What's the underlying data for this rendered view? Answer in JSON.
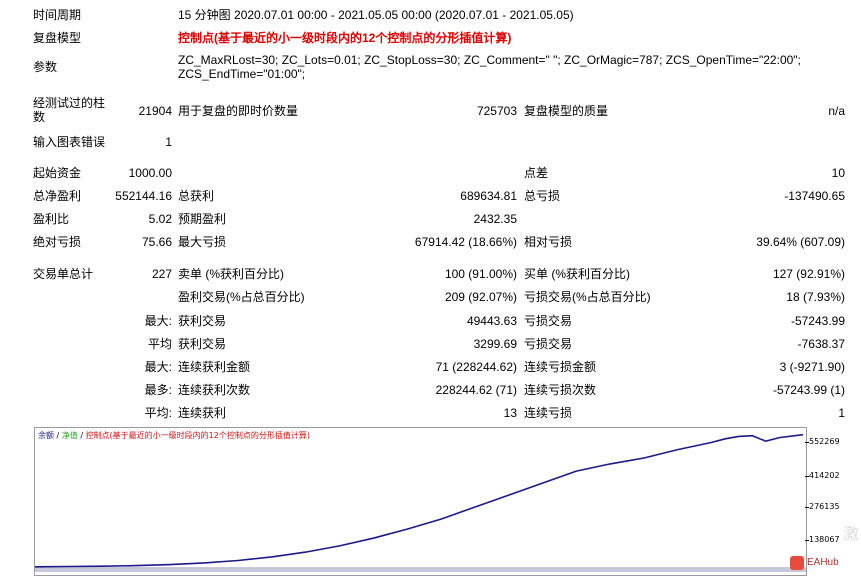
{
  "report": {
    "period_label": "时间周期",
    "period_value": "15 分钟图 2020.07.01 00:00 - 2021.05.05 00:00 (2020.07.01 - 2021.05.05)",
    "model_label": "复盘模型",
    "model_value": "控制点(基于最近的小一级时段内的12个控制点的分形插值计算)",
    "params_label": "参数",
    "params_value": "ZC_MaxRLost=30; ZC_Lots=0.01; ZC_StopLoss=30; ZC_Comment=\" \"; ZC_OrMagic=787; ZCS_OpenTime=\"22:00\"; ZCS_EndTime=\"01:00\";",
    "bars_label": "经测试过的柱数",
    "bars_value": "21904",
    "ticks_label": "用于复盘的即时价数量",
    "ticks_value": "725703",
    "quality_label": "复盘模型的质量",
    "quality_value": "n/a",
    "errors_label": "输入图表错误",
    "errors_value": "1",
    "deposit_label": "起始资金",
    "deposit_value": "1000.00",
    "spread_label": "点差",
    "spread_value": "10",
    "net_profit_label": "总净盈利",
    "net_profit_value": "552144.16",
    "gross_profit_label": "总获利",
    "gross_profit_value": "689634.81",
    "gross_loss_label": "总亏损",
    "gross_loss_value": "-137490.65",
    "profit_factor_label": "盈利比",
    "profit_factor_value": "5.02",
    "expected_payoff_label": "预期盈利",
    "expected_payoff_value": "2432.35",
    "abs_dd_label": "绝对亏损",
    "abs_dd_value": "75.66",
    "max_dd_label": "最大亏损",
    "max_dd_value": "67914.42 (18.66%)",
    "rel_dd_label": "相对亏损",
    "rel_dd_value": "39.64% (607.09)",
    "total_trades_label": "交易单总计",
    "total_trades_value": "227",
    "short_label": "卖单 (%获利百分比)",
    "short_value": "100 (91.00%)",
    "long_label": "买单 (%获利百分比)",
    "long_value": "127 (92.91%)",
    "profit_trades_label": "盈利交易(%占总百分比)",
    "profit_trades_value": "209 (92.07%)",
    "loss_trades_label": "亏损交易(%占总百分比)",
    "loss_trades_value": "18 (7.93%)",
    "largest_prefix": "最大:",
    "largest_profit_label": "获利交易",
    "largest_profit_value": "49443.63",
    "largest_loss_label": "亏损交易",
    "largest_loss_value": "-57243.99",
    "average_prefix": "平均",
    "average_profit_label": "获利交易",
    "average_profit_value": "3299.69",
    "average_loss_label": "亏损交易",
    "average_loss_value": "-7638.37",
    "max_consec_prefix": "最大:",
    "max_consec_wins_label": "连续获利金额",
    "max_consec_wins_value": "71 (228244.62)",
    "max_consec_losses_label": "连续亏损金额",
    "max_consec_losses_value": "3 (-9271.90)",
    "most_prefix": "最多:",
    "most_consec_wins_label": "连续获利次数",
    "most_consec_wins_value": "228244.62 (71)",
    "most_consec_losses_label": "连续亏损次数",
    "most_consec_losses_value": "-57243.99 (1)",
    "avg_consec_prefix": "平均:",
    "avg_consec_wins_label": "连续获利",
    "avg_consec_wins_value": "13",
    "avg_consec_losses_label": "连续亏损",
    "avg_consec_losses_value": "1"
  },
  "chart_legend": {
    "balance": "余额",
    "sep1": " / ",
    "equity": "净值",
    "sep2": " / ",
    "model": "控制点(基于最近的小一级时段内的12个控制点的分形插值计算)"
  },
  "watermark": {
    "logo_text": "EAHub",
    "cn_text": "激"
  },
  "colors": {
    "balance_line": "#1a1a8c",
    "model_text": "#e00000",
    "chart_border": "#9a9a9a"
  },
  "chart_data": {
    "type": "line",
    "title": "",
    "xlabel": "",
    "ylabel": "",
    "ylim": [
      0,
      580000
    ],
    "yticks": [
      138067,
      276135,
      414202,
      552269
    ],
    "ytick_labels": [
      "138067",
      "276135",
      "414202",
      "552269"
    ],
    "grid": false,
    "series": [
      {
        "name": "余额",
        "x": [
          0,
          10,
          20,
          30,
          40,
          50,
          60,
          70,
          80,
          90,
          100,
          110,
          120,
          130,
          140,
          150,
          160,
          170,
          180,
          190,
          200,
          204,
          208,
          212,
          216,
          220,
          227
        ],
        "values": [
          1000,
          2000,
          3500,
          6000,
          10000,
          17000,
          27000,
          42000,
          62000,
          88000,
          120000,
          158000,
          200000,
          250000,
          300000,
          350000,
          400000,
          430000,
          455000,
          490000,
          520000,
          535000,
          545000,
          548000,
          525000,
          540000,
          552144
        ]
      }
    ]
  }
}
